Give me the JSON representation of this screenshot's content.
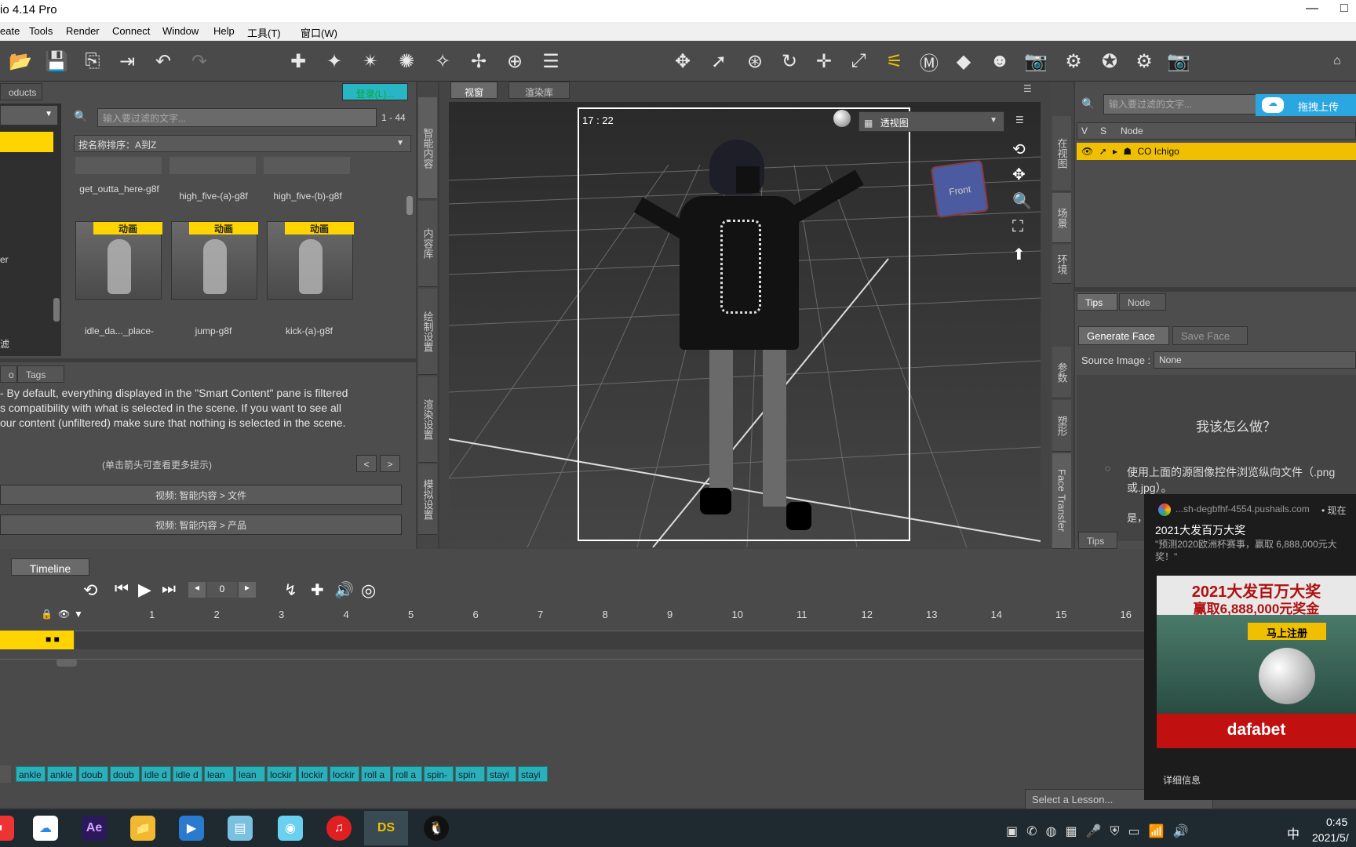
{
  "window": {
    "title": "io 4.14 Pro",
    "minimize": "—",
    "maximize": "□"
  },
  "menu": [
    "eate",
    "Tools",
    "Render",
    "Connect",
    "Window",
    "Help",
    "工具(T)",
    "窗口(W)"
  ],
  "left": {
    "tabs": {
      "products": "oducts",
      "login": "登录(L)..."
    },
    "filter_placeholder": "输入要过滤的文字...",
    "count": "1 - 44",
    "sort": "按名称排序：A到Z",
    "side_items": [
      "er",
      "滤"
    ],
    "row1": [
      "get_outta_here-g8f",
      "high_five-(a)-g8f",
      "high_five-(b)-g8f"
    ],
    "badge": "动画",
    "row2": [
      "idle_da..._place-",
      "jump-g8f",
      "kick-(a)-g8f"
    ],
    "vtabs": [
      "智能内容",
      "内容库",
      "绘制设置",
      "渲染设置",
      "模拟设置"
    ]
  },
  "info": {
    "tabs": [
      "o",
      "Tags"
    ],
    "text1": "- By default, everything displayed in the \"Smart Content\" pane is filtered",
    "text2": "s compatibility with what is selected in the scene. If you want to see all",
    "text3": "our content (unfiltered) make sure that nothing is selected in the scene.",
    "hint": "(单击箭头可查看更多提示)",
    "prev": "<",
    "next": ">",
    "video1": "视频: 智能内容 > 文件",
    "video2": "视频: 智能内容 > 产品"
  },
  "viewport": {
    "tabs": [
      "视窗",
      "渲染库"
    ],
    "time": "17 : 22",
    "view": "透视图",
    "cube": "Front"
  },
  "right": {
    "filter_placeholder": "输入要过滤的文字...",
    "upload": "拖拽上传",
    "cols": [
      "V",
      "S",
      "Node"
    ],
    "node": "CO Ichigo",
    "vtabs": [
      "在视图",
      "场景",
      "环境",
      "参数",
      "塑形",
      "Face Transfer"
    ],
    "tabs": [
      "Tips",
      "Node"
    ],
    "face_tabs": [
      "Generate Face",
      "Save Face"
    ],
    "source_label": "Source Image :",
    "source_value": "None",
    "howto": "我该怎么做？",
    "hint": "使用上面的源图像控件浏览纵向文件（.png",
    "hint2": "或.jpg）。",
    "more": "是，",
    "tips": "Tips"
  },
  "timeline": {
    "tab": "Timeline",
    "frame": "0",
    "ticks": [
      "1",
      "2",
      "3",
      "4",
      "5",
      "6",
      "7",
      "8",
      "9",
      "10",
      "11",
      "12",
      "13",
      "14",
      "15",
      "16"
    ]
  },
  "chips": [
    "ankle",
    "ankle",
    "doub",
    "doub",
    "idle d",
    "idle d",
    "lean",
    "lean",
    "lockir",
    "lockir",
    "lockir",
    "roll a",
    "roll a",
    "spin-",
    "spin",
    "stayi",
    "stayi"
  ],
  "lesson": "Select a Lesson...",
  "popup": {
    "source": "...sh-degbfhf-4554.pushails.com",
    "now": "• 现在",
    "title": "2021大发百万大奖",
    "body": "\"预测2020欧洲杯赛事，赢取 6,888,000元大奖！\"",
    "ad_title": "2021大发百万大奖",
    "ad_sub": "赢取6,888,000元奖金",
    "ad_btn": "马上注册",
    "brand": "dafabet",
    "details": "详细信息"
  },
  "tray": {
    "ime": "中",
    "time": "0:45",
    "date": "2021/5/"
  }
}
